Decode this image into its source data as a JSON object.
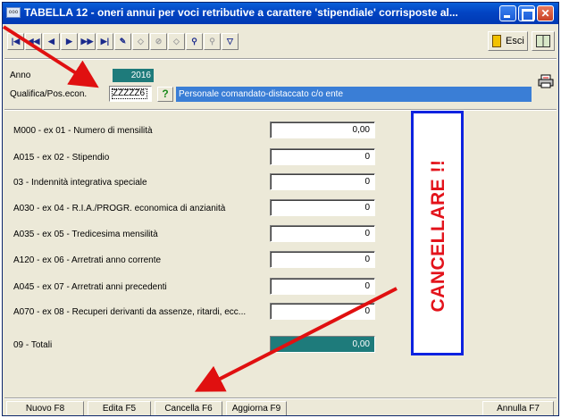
{
  "window": {
    "title": "TABELLA 12 - oneri annui per voci retributive a carattere 'stipendiale' corrisposte al...",
    "app_icon_text": "ooo"
  },
  "toolbar": {
    "nav_icons": [
      "first-record-icon",
      "prev-page-icon",
      "prev-record-icon",
      "next-record-icon",
      "next-page-icon",
      "last-record-icon",
      "edit-record-icon",
      "insert-record-icon",
      "delete-record-icon",
      "confirm-record-icon",
      "search-icon",
      "filter-icon",
      "clear-filter-icon"
    ],
    "esci_label": "Esci"
  },
  "header": {
    "anno_label": "Anno",
    "anno_value": "2016",
    "qualifica_label": "Qualifica/Pos.econ.",
    "qualifica_value": "ZZZZZ6",
    "help_glyph": "?",
    "qualifica_description": "Personale comandato-distaccato c/o ente"
  },
  "rows": [
    {
      "label": "M000 - ex 01 - Numero di mensilità",
      "value": "0,00"
    },
    {
      "label": "A015 - ex 02 - Stipendio",
      "value": "0"
    },
    {
      "label": "03 - Indennità integrativa speciale",
      "value": "0"
    },
    {
      "label": "A030 - ex 04 - R.I.A./PROGR. economica di anzianità",
      "value": "0"
    },
    {
      "label": "A035 - ex 05 - Tredicesima mensilità",
      "value": "0"
    },
    {
      "label": "A120 - ex 06 - Arretrati anno corrente",
      "value": "0"
    },
    {
      "label": "A045 - ex 07 - Arretrati anni precedenti",
      "value": "0"
    },
    {
      "label": "A070 - ex 08 - Recuperi derivanti da assenze, ritardi, ecc...",
      "value": "0"
    }
  ],
  "total": {
    "label": "09 - Totali",
    "value": "0,00"
  },
  "annotation": {
    "text": "CANCELLARE !!",
    "text_color": "#e3131b",
    "border_color": "#0d22e0",
    "arrow_color": "#e01010"
  },
  "bottom_buttons": {
    "nuovo": "Nuovo F8",
    "edita": "Edita F5",
    "cancella": "Cancella F6",
    "aggiorna": "Aggiorna F9",
    "annulla": "Annulla F7"
  }
}
